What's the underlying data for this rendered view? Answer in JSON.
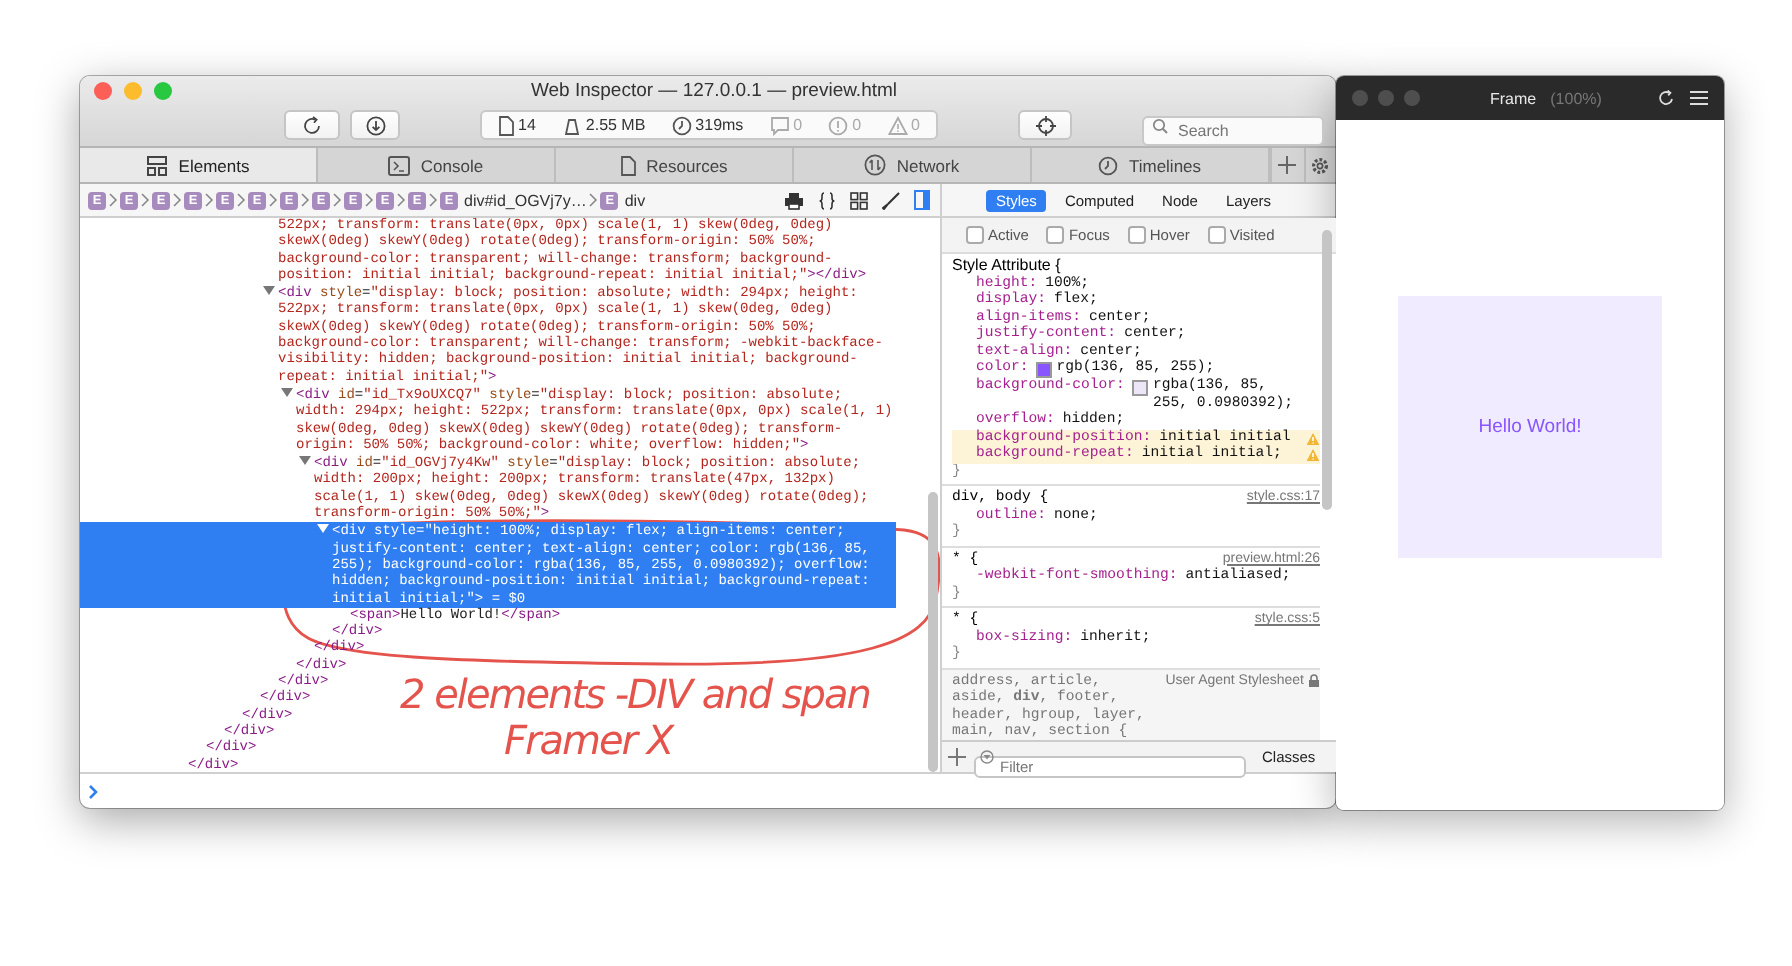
{
  "inspector": {
    "title": "Web Inspector — 127.0.0.1 — preview.html",
    "toolbar": {
      "stats": [
        {
          "kind": "document",
          "text": "14"
        },
        {
          "kind": "weight",
          "text": "2.55 MB"
        },
        {
          "kind": "clock",
          "text": "319ms"
        },
        {
          "kind": "message",
          "text": "0"
        },
        {
          "kind": "error",
          "text": "0"
        },
        {
          "kind": "warning",
          "text": "0"
        }
      ],
      "search": {
        "placeholder": "Search"
      }
    },
    "tabs": [
      {
        "label": "Elements",
        "selected": true
      },
      {
        "label": "Console",
        "selected": false
      },
      {
        "label": "Resources",
        "selected": false
      },
      {
        "label": "Network",
        "selected": false
      },
      {
        "label": "Timelines",
        "selected": false
      }
    ],
    "breadcrumb": [
      {
        "badge": "E"
      },
      {
        "badge": "E"
      },
      {
        "badge": "E"
      },
      {
        "badge": "E"
      },
      {
        "badge": "E"
      },
      {
        "badge": "E"
      },
      {
        "badge": "E"
      },
      {
        "badge": "E"
      },
      {
        "badge": "E"
      },
      {
        "badge": "E"
      },
      {
        "badge": "E"
      },
      {
        "badge": "E",
        "label": "div#id_OGVj7y…"
      },
      {
        "badge": "E",
        "label": "div"
      }
    ],
    "sidebar_tabs": [
      {
        "label": "Styles",
        "selected": true
      },
      {
        "label": "Computed",
        "selected": false
      },
      {
        "label": "Node",
        "selected": false
      },
      {
        "label": "Layers",
        "selected": false
      }
    ],
    "dom_tree": [
      {
        "kind": "scrolled",
        "close": "</div>",
        "children": [
          {
            "kind": "scrolled",
            "close": "</div>",
            "children": [
              {
                "kind": "scrolled",
                "close": "</div>",
                "children": [
                  {
                    "kind": "scrolled",
                    "close": "</div>",
                    "children": [
                      {
                        "kind": "scrolled",
                        "close": "</div>",
                        "children": [
                          {
                            "kind": "fragment",
                            "text": "522px; transform: translate(0px, 0px) scale(1, 1) skew(0deg, 0deg) skewX(0deg) skewY(0deg) rotate(0deg); transform-origin: 50% 50%; background-color: transparent; will-change: transform; background-position: initial initial; background-repeat: initial initial;\"",
                            "close": "></div>"
                          },
                          {
                            "kind": "element",
                            "expanded": true,
                            "selected": false,
                            "open": "<div style=\"display: block; position: absolute; width: 294px; height: 522px; transform: translate(0px, 0px) scale(1, 1) skew(0deg, 0deg) skewX(0deg) skewY(0deg) rotate(0deg); transform-origin: 50% 50%; background-color: transparent; will-change: transform; -webkit-backface-visibility: hidden; background-position: initial initial; background-repeat: initial initial;\">",
                            "close": "</div>",
                            "children": [
                              {
                                "kind": "element",
                                "expanded": true,
                                "selected": false,
                                "open": "<div id=\"id_Tx9oUXCQ7\" style=\"display: block; position: absolute; width: 294px; height: 522px; transform: translate(0px, 0px) scale(1, 1) skew(0deg, 0deg) skewX(0deg) skewY(0deg) rotate(0deg); transform-origin: 50% 50%; background-color: white; overflow: hidden;\">",
                                "close": "</div>",
                                "children": [
                                  {
                                    "kind": "element",
                                    "expanded": true,
                                    "selected": false,
                                    "open": "<div id=\"id_OGVj7y4Kw\" style=\"display: block; position: absolute; width: 200px; height: 200px; transform: translate(47px, 132px) scale(1, 1) skew(0deg, 0deg) skewX(0deg) skewY(0deg) rotate(0deg); transform-origin: 50% 50%;\">",
                                    "close": "</div>",
                                    "children": [
                                      {
                                        "kind": "element",
                                        "expanded": true,
                                        "selected": true,
                                        "open": "<div style=\"height: 100%; display: flex; align-items: center; justify-content: center; text-align: center; color: rgb(136, 85, 255); background-color: rgba(136, 85, 255, 0.0980392); overflow: hidden; background-position: initial initial; background-repeat: initial initial;\">",
                                        "console_ref": "= $0",
                                        "close": "</div>",
                                        "children": [
                                          {
                                            "kind": "text-element",
                                            "text": "<span>Hello World!</span>"
                                          }
                                        ]
                                      }
                                    ]
                                  }
                                ]
                              }
                            ]
                          }
                        ]
                      }
                    ]
                  }
                ]
              }
            ]
          }
        ]
      }
    ],
    "styles": {
      "pseudo_classes": [
        {
          "label": "Active",
          "checked": false
        },
        {
          "label": "Focus",
          "checked": false
        },
        {
          "label": "Hover",
          "checked": false
        },
        {
          "label": "Visited",
          "checked": false
        }
      ],
      "rules": [
        {
          "selector": "Style Attribute {",
          "close": "}",
          "properties": [
            {
              "name": "height:",
              "value": "100%;",
              "warning": false
            },
            {
              "name": "display:",
              "value": "flex;",
              "warning": false
            },
            {
              "name": "align-items:",
              "value": "center;",
              "warning": false
            },
            {
              "name": "justify-content:",
              "value": "center;",
              "warning": false
            },
            {
              "name": "text-align:",
              "value": "center;",
              "warning": false
            },
            {
              "name": "color:",
              "color": "#8855ff",
              "value": "rgb(136, 85, 255);",
              "warning": false
            },
            {
              "name": "background-color:",
              "color": "#ece6f8",
              "value": "rgba(136, 85, 255, 0.0980392);",
              "warning": false
            },
            {
              "name": "overflow:",
              "value": "hidden;",
              "warning": false
            },
            {
              "name": "background-position:",
              "value": "initial initial",
              "warning": true
            },
            {
              "name": "background-repeat:",
              "value": "initial initial;",
              "warning": true
            }
          ]
        },
        {
          "selector": "div, body {",
          "source": "style.css:17",
          "close": "}",
          "properties": [
            {
              "name": "outline:",
              "value": "none;",
              "warning": false
            }
          ]
        },
        {
          "selector": "* {",
          "source": "preview.html:26",
          "close": "}",
          "properties": [
            {
              "name": "-webkit-font-smoothing:",
              "value": "antialiased;",
              "warning": false
            }
          ]
        },
        {
          "selector": "* {",
          "source": "style.css:5",
          "close": "}",
          "properties": [
            {
              "name": "box-sizing:",
              "value": "inherit;",
              "warning": false
            }
          ]
        },
        {
          "selector": "address, article, aside, **div**, footer, header, hgroup, layer, main, nav, section {",
          "source": "User Agent Stylesheet",
          "locked": true
        }
      ],
      "filter": {
        "placeholder": "Filter"
      },
      "classes_button": "Classes"
    }
  },
  "frame_window": {
    "title": "Frame",
    "zoom": "(100%)",
    "content_text": "Hello World!"
  },
  "annotation": {
    "lines": [
      "2 elements -DIV and span",
      "Framer X"
    ]
  }
}
